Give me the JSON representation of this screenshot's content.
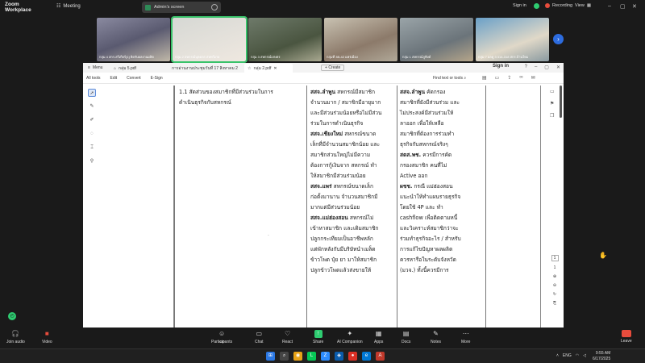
{
  "zoom": {
    "brand_line1": "Zoom",
    "brand_line2": "Workplace",
    "meeting_label": "Meeting",
    "screen_share_label": "Admin's screen",
    "sign_in": "Sign in",
    "recording": "Recording",
    "view": "View"
  },
  "participants_strip": [
    {
      "caption": "กลุ่ม 4 สกร.สวีเกียร์(1) ยิดรับผลงานผลิต"
    },
    {
      "caption": "กลุ่ม 2 สหกรณ์บุคคลร สหทวีเกษ"
    },
    {
      "caption": "กลุ่ม 3 สหกรณ์เกษตร"
    },
    {
      "caption": "กลุ่มที่ 3B-42 แพร่เมือง"
    },
    {
      "caption": "กลุ่ม 1 สหกรณ์ภูพิงค์"
    },
    {
      "caption": "กลุ่ม 7 ผลดู 3 314-318 สกร.บ้านใหม่"
    }
  ],
  "pdf": {
    "menu": "Menu",
    "tabs": [
      "กลุ่ม 5.pdf",
      "การอ่านงานประชุมวันที่ 17 สิงหาคม 2568",
      "กลุ่ม 2.pdf"
    ],
    "create": "Create",
    "sign_in": "Sign in",
    "toolbar": [
      "All tools",
      "Edit",
      "Convert",
      "E-Sign"
    ],
    "find_text": "Find text or tools",
    "col1": [
      "1.1 สัดส่วนของสมาชิกที่มีส่วนร่วมในการ",
      "ดำเนินธุรกิจกับสหกรณ์"
    ],
    "col2": [
      {
        "b": "สสจ.ลำพูน",
        "t": " สหกรณ์มีสมาชิก"
      },
      {
        "b": "",
        "t": "จำนวนมาก / สมาชิกมีอายุมาก"
      },
      {
        "b": "",
        "t": "และมีส่วนร่วมน้อยหรือไม่มีส่วน"
      },
      {
        "b": "",
        "t": "ร่วมในการดำเนินธุรกิจ"
      },
      {
        "b": "สสจ.เชียงใหม่",
        "t": " สหกรณ์ขนาด"
      },
      {
        "b": "",
        "t": "เล็กที่มีจำนวนสมาชิกน้อย และ"
      },
      {
        "b": "",
        "t": "สมาชิกส่วนใหญ่ไม่มีความ"
      },
      {
        "b": "",
        "t": "ต้องการกู้เงินจาก สหกรณ์ ทำ"
      },
      {
        "b": "",
        "t": "ให้สมาชิกมีส่วนร่วมน้อย"
      },
      {
        "b": "สสจ.แพร่",
        "t": " สหกรณ์ขนาดเล็ก"
      },
      {
        "b": "",
        "t": "ก่อตั้งมานาน จำนวนสมาชิกมี"
      },
      {
        "b": "",
        "t": "มากแต่มีส่วนร่วมน้อย"
      },
      {
        "b": "สสจ.แม่ฮ่องสอน",
        "t": " สหกรณ์ไม่"
      },
      {
        "b": "",
        "t": "เข้าหาสมาชิก และเดิมสมาชิก"
      },
      {
        "b": "",
        "t": "ปลูกกระเทียมเป็นอาชีพหลัก"
      },
      {
        "b": "",
        "t": "แต่พักหลังกับมีบริษัทนำเมล็ด"
      },
      {
        "b": "",
        "t": "ข้าวโพด ปุ๋ย ยา มาให้สมาชิก"
      },
      {
        "b": "",
        "t": "ปลูกข้าวโพดแล้วส่งขายให้"
      }
    ],
    "col3": [
      {
        "b": "สสจ.ลำพูน",
        "t": " คัดกรอง"
      },
      {
        "b": "",
        "t": "สมาชิกที่ยังมีส่วนร่วม และ"
      },
      {
        "b": "",
        "t": "ไม่ประสงค์มีส่วนร่วมให้"
      },
      {
        "b": "",
        "t": "ลาออก เพื่อให้เหลือ"
      },
      {
        "b": "",
        "t": "สมาชิกที่ต้องการร่วมทำ"
      },
      {
        "b": "",
        "t": "ธุรกิจกับสหกรณ์จริงๆ"
      },
      {
        "b": "สตส.พช.",
        "t": " ควรมีการคัด"
      },
      {
        "b": "",
        "t": "กรองสมาชิก คนที่ไม่"
      },
      {
        "b": "",
        "t": "Active ออก"
      },
      {
        "b": "ผชช.",
        "t": " กรณี แม่ฮ่องสอน"
      },
      {
        "b": "",
        "t": "แนะนำให้ทำแผนรายธุรกิจ"
      },
      {
        "b": "",
        "t": "โดยใช้ 4P และ ทำ"
      },
      {
        "b": "",
        "t": "cashflow เพื่อติดตามหนี้"
      },
      {
        "b": "",
        "t": "และวิเคราะห์สมาชิกว่าจะ"
      },
      {
        "b": "",
        "t": "ร่วมทำธุรกิจอะไร / สำหรับ"
      },
      {
        "b": "",
        "t": "การแก้ไขปัญหาผลผลิต"
      },
      {
        "b": "",
        "t": "ควรหารือในระดับจังหวัด"
      },
      {
        "b": "",
        "t": "(มวจ.) ทั้งนี้ควรมีการ"
      }
    ]
  },
  "page_indicator": {
    "current": "1",
    "total": "1"
  },
  "bottombar": {
    "join_audio": "Join audio",
    "video": "Video",
    "participants": "Participants",
    "participants_count": "450",
    "chat": "Chat",
    "react": "React",
    "share": "Share",
    "ai_companion": "AI Companion",
    "apps": "Apps",
    "docs": "Docs",
    "notes": "Notes",
    "more": "More",
    "leave": "Leave"
  },
  "taskbar": {
    "lang": "ENG",
    "time": "9:55 AM",
    "date": "6/17/2025"
  }
}
